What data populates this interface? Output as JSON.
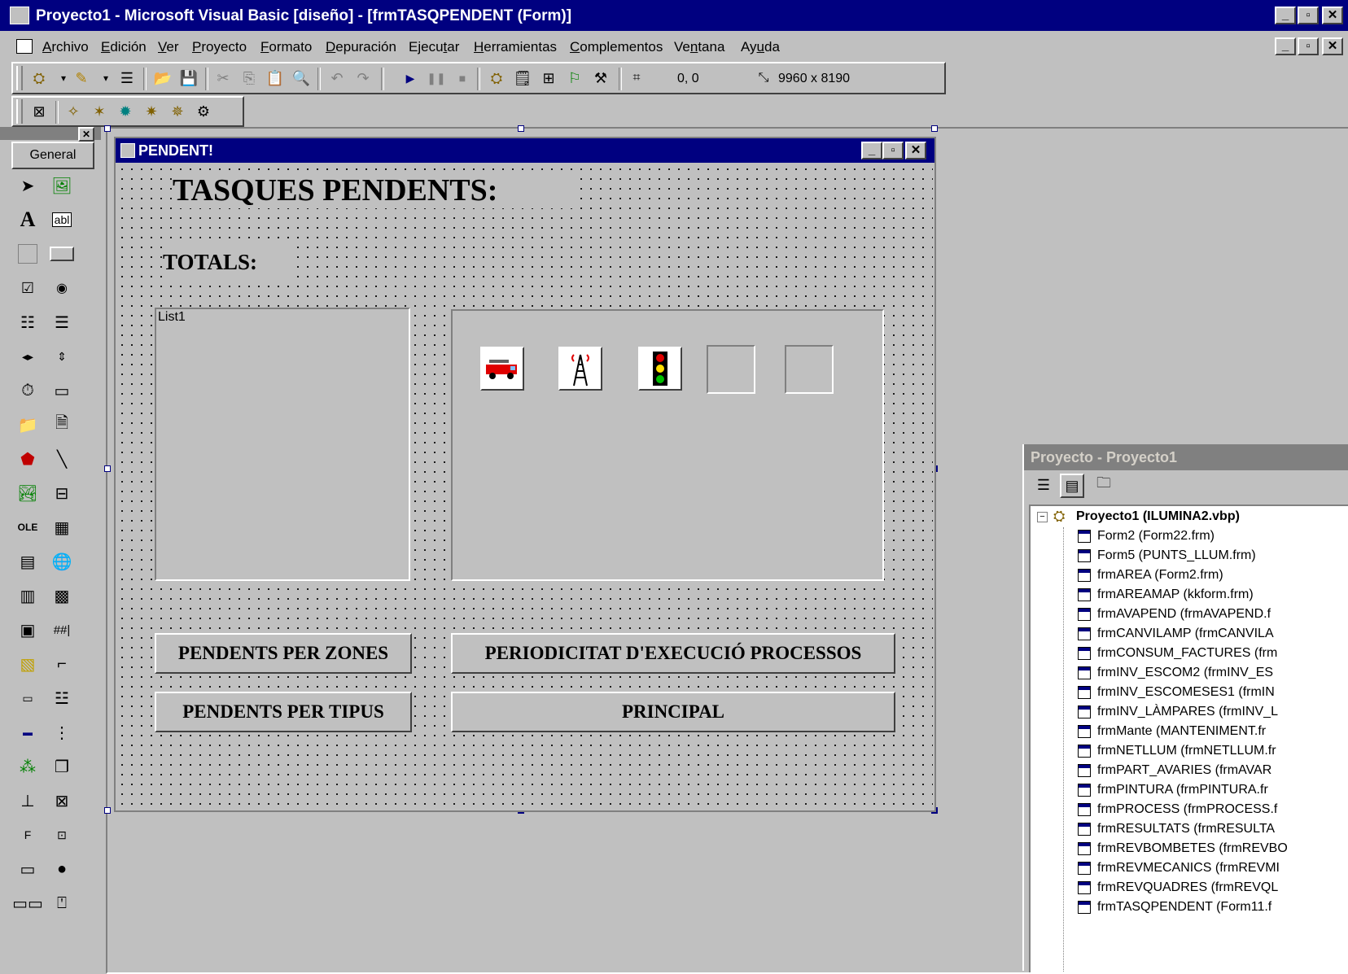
{
  "window": {
    "title": "Proyecto1 - Microsoft Visual Basic [diseño] - [frmTASQPENDENT (Form)]",
    "minimize": "_",
    "maximize": "▫",
    "close": "✕"
  },
  "menu": [
    {
      "pre": "",
      "key": "A",
      "post": "rchivo"
    },
    {
      "pre": "",
      "key": "E",
      "post": "dición"
    },
    {
      "pre": "",
      "key": "V",
      "post": "er"
    },
    {
      "pre": "",
      "key": "P",
      "post": "royecto"
    },
    {
      "pre": "",
      "key": "F",
      "post": "ormato"
    },
    {
      "pre": "",
      "key": "D",
      "post": "epuración"
    },
    {
      "pre": "Ejecu",
      "key": "t",
      "post": "ar"
    },
    {
      "pre": "",
      "key": "H",
      "post": "erramientas"
    },
    {
      "pre": "",
      "key": "C",
      "post": "omplementos"
    },
    {
      "pre": "Ve",
      "key": "n",
      "post": "tana"
    },
    {
      "pre": "Ay",
      "key": "u",
      "post": "da"
    }
  ],
  "toolbar": {
    "position": "0, 0",
    "size": "9960 x 8190"
  },
  "toolbox": {
    "tab_label": "General",
    "close": "✕"
  },
  "form": {
    "caption": "PENDENT!",
    "heading": "TASQUES PENDENTS:",
    "totals_label": "TOTALS:",
    "list_text": "List1",
    "buttons": {
      "zones": "PENDENTS PER ZONES",
      "periodicitat": "PERIODICITAT  D'EXECUCIÓ PROCESSOS",
      "tipus": "PENDENTS PER TIPUS",
      "principal": "PRINCIPAL"
    },
    "icons": [
      "fire-truck-icon",
      "radio-tower-icon",
      "traffic-light-icon"
    ]
  },
  "project": {
    "title": "Proyecto - Proyecto1",
    "root": "Proyecto1 (ILUMINA2.vbp)",
    "items": [
      "Form2 (Form22.frm)",
      "Form5 (PUNTS_LLUM.frm)",
      "frmAREA (Form2.frm)",
      "frmAREAMAP (kkform.frm)",
      "frmAVAPEND (frmAVAPEND.f",
      "frmCANVILAMP (frmCANVILA",
      "frmCONSUM_FACTURES (frm",
      "frmINV_ESCOM2 (frmINV_ES",
      "frmINV_ESCOMESES1 (frmIN",
      "frmINV_LÀMPARES (frmINV_L",
      "frmMante (MANTENIMENT.fr",
      "frmNETLLUM (frmNETLLUM.fr",
      "frmPART_AVARIES (frmAVAR",
      "frmPINTURA (frmPINTURA.fr",
      "frmPROCESS (frmPROCESS.f",
      "frmRESULTATS (frmRESULTA",
      "frmREVBOMBETES (frmREVBO",
      "frmREVMECANICS (frmREVMI",
      "frmREVQUADRES (frmREVQL",
      "frmTASQPENDENT (Form11.f"
    ]
  }
}
